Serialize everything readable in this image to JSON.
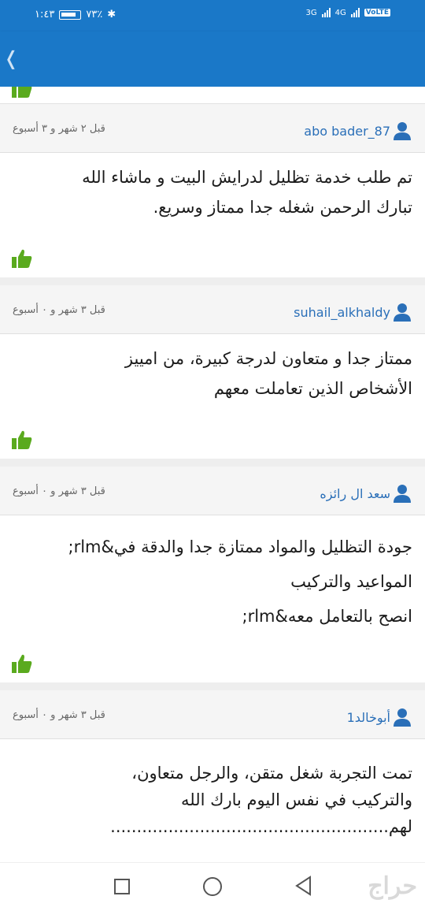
{
  "status_bar": {
    "time": "١:٤٣",
    "battery": "٧٣٪",
    "net1": "3G",
    "net2": "4G",
    "volte": "VoLTE"
  },
  "header": {
    "back_icon": "chevron-left-icon"
  },
  "colors": {
    "header_bg": "#1a78c8",
    "username": "#2a6fb8",
    "thumb_green": "#5aaa1e"
  },
  "reviews": [
    {
      "username": "abo bader_87",
      "date": "قبل ٢ شهر و ٣ أسبوع",
      "lines": [
        "تم طلب خدمة تظليل لدرايش البيت و ماشاء الله",
        "تبارك الرحمن  شغله جدا ممتاز وسريع."
      ]
    },
    {
      "username": "suhail_alkhaldy",
      "date": "قبل ٣ شهر و ٠ أسبوع",
      "lines": [
        "ممتاز جدا و متعاون لدرجة كبيرة، من امييز",
        "الأشخاص الذين تعاملت معهم"
      ]
    },
    {
      "username": "سعد ال رائزه",
      "date": "قبل ٣ شهر و ٠ أسبوع",
      "lines": [
        "جودة التظليل والمواد ممتازة جدا والدقة في&rlm;",
        "المواعيد والتركيب",
        "انصح بالتعامل معه&rlm;"
      ]
    },
    {
      "username": "1أبوخالد",
      "date": "قبل ٣ شهر و ٠ أسبوع",
      "lines": [
        "تمت التجربة شغل متقن، والرجل متعاون،",
        "والتركيب في نفس اليوم بارك الله",
        "لهم.....................................................",
        "...................................................................",
        "..................................................................."
      ]
    }
  ],
  "navbar": {
    "watermark": "حراج"
  }
}
